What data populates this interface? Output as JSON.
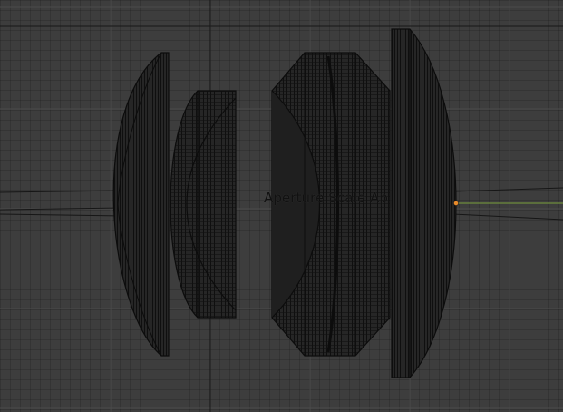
{
  "viewport": {
    "object_label": "Aperture Scale Ap",
    "colors": {
      "background": "#3d3d3d",
      "grid_minor": "#363636",
      "grid_major": "#4f4f4f",
      "wireframe": "#0c0c0c",
      "lens_fill": "#242424",
      "optical_axis_ray": "#6e8c3c",
      "origin_dot": "#e88a2a"
    },
    "icons": {
      "lens_group": "wireframe-lens-mesh",
      "origin": "object-origin-dot"
    }
  }
}
